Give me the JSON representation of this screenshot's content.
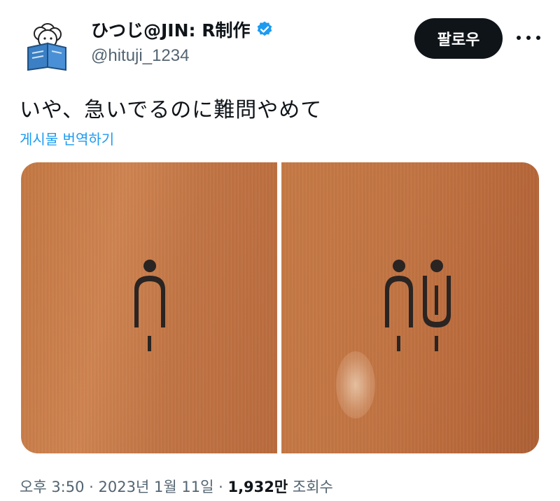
{
  "author": {
    "display_name": "ひつじ@JIN: R制作",
    "handle": "@hituji_1234",
    "verified": true
  },
  "actions": {
    "follow_label": "팔로우",
    "more_icon": "more-horizontal-icon"
  },
  "tweet": {
    "text": "いや、急いでるのに難問やめて",
    "translate_label": "게시물 번역하기"
  },
  "media": {
    "photos": [
      "restroom-sign-single-figure",
      "restroom-sign-two-figures"
    ]
  },
  "meta": {
    "time": "오후 3:50",
    "separator": "·",
    "date": "2023년 1월 11일",
    "views_count": "1,932만",
    "views_label": "조회수"
  },
  "colors": {
    "accent": "#1d9bf0",
    "text": "#0f1419",
    "secondary": "#536471",
    "wood": "#c47843"
  }
}
